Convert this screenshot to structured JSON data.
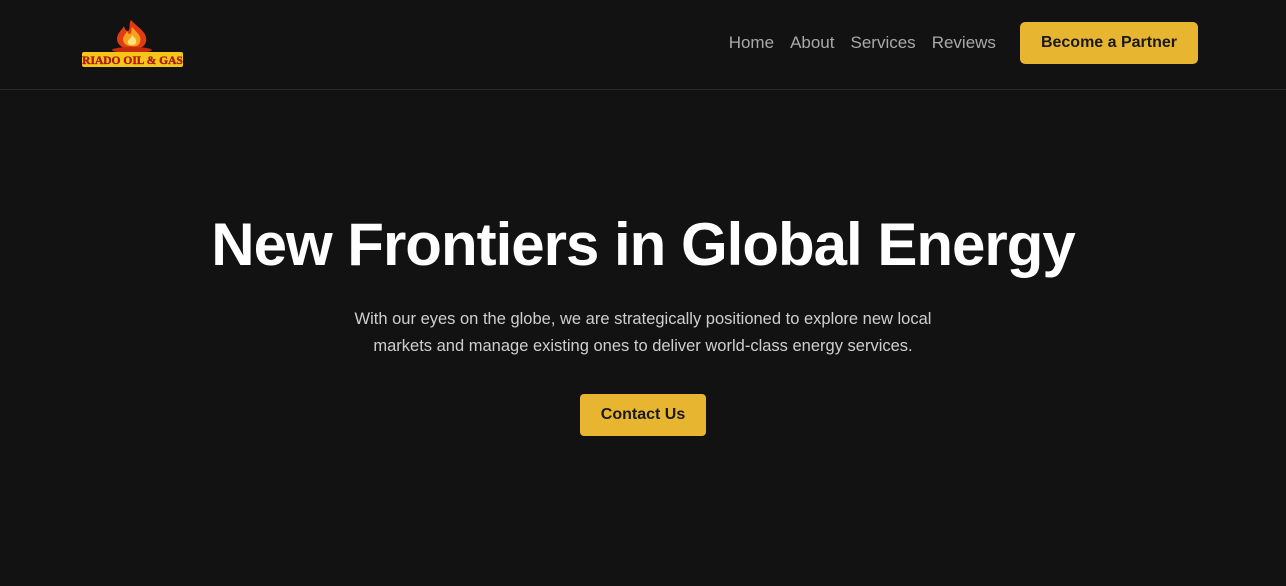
{
  "brand": {
    "logo_text": "RIADO OIL & GAS",
    "logo_icon": "flame-icon",
    "accent_color": "#e8b531",
    "background_color": "#121212"
  },
  "nav": {
    "links": [
      "Home",
      "About",
      "Services",
      "Reviews"
    ],
    "cta_label": "Become a Partner"
  },
  "hero": {
    "title": "New Frontiers in Global Energy",
    "description": "With our eyes on the globe, we are strategically positioned to explore new local markets and manage existing ones to deliver world-class energy services.",
    "cta_label": "Contact Us"
  }
}
